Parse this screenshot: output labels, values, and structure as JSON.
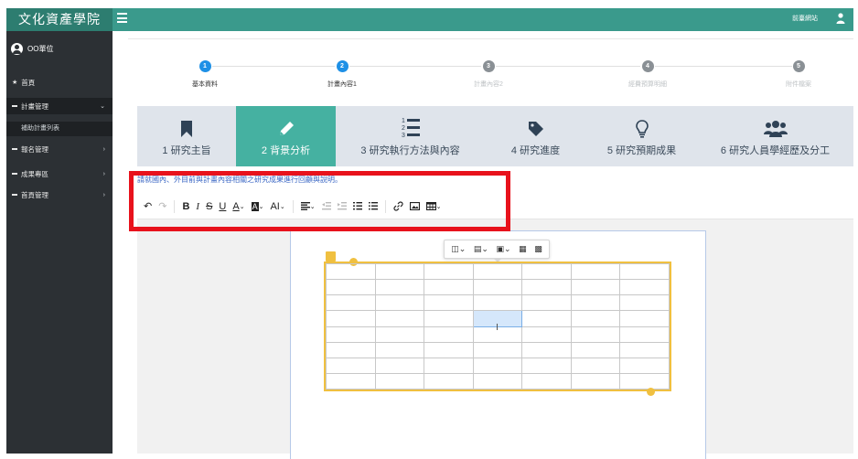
{
  "app": {
    "title": "文化資產學院",
    "front_link": "前臺網站"
  },
  "sidebar": {
    "unit": "OO單位",
    "items": [
      {
        "label": "首頁"
      },
      {
        "label": "計畫管理"
      },
      {
        "label": "補助計畫列表"
      },
      {
        "label": "報名管理"
      },
      {
        "label": "成果專區"
      },
      {
        "label": "首頁管理"
      }
    ]
  },
  "steps": [
    {
      "num": "1",
      "label": "基本資料"
    },
    {
      "num": "2",
      "label": "計畫內容1"
    },
    {
      "num": "3",
      "label": "計畫內容2"
    },
    {
      "num": "4",
      "label": "經費預算明細"
    },
    {
      "num": "5",
      "label": "附件檔案"
    }
  ],
  "tabs": [
    {
      "label": "1 研究主旨",
      "icon": "bookmark-icon"
    },
    {
      "label": "2 背景分析",
      "icon": "pencil-icon"
    },
    {
      "label": "3 研究執行方法與內容",
      "icon": "numbered-list-icon"
    },
    {
      "label": "4 研究進度",
      "icon": "tag-icon"
    },
    {
      "label": "5 研究預期成果",
      "icon": "lightbulb-icon"
    },
    {
      "label": "6 研究人員學經歷及分工",
      "icon": "users-icon"
    }
  ],
  "editor": {
    "instruction": "請就國內、外目前與計畫內容相關之研究成果進行回顧與說明。",
    "toolbar": {
      "undo": "↶",
      "redo": "↷",
      "bold": "B",
      "italic": "I",
      "strike": "S",
      "underline": "U",
      "font_color": "A",
      "bg_color": "A",
      "font_size": "AI"
    }
  },
  "table": {
    "rows": 8,
    "cols": 7,
    "selected_cell": {
      "row": 3,
      "col": 3
    }
  }
}
